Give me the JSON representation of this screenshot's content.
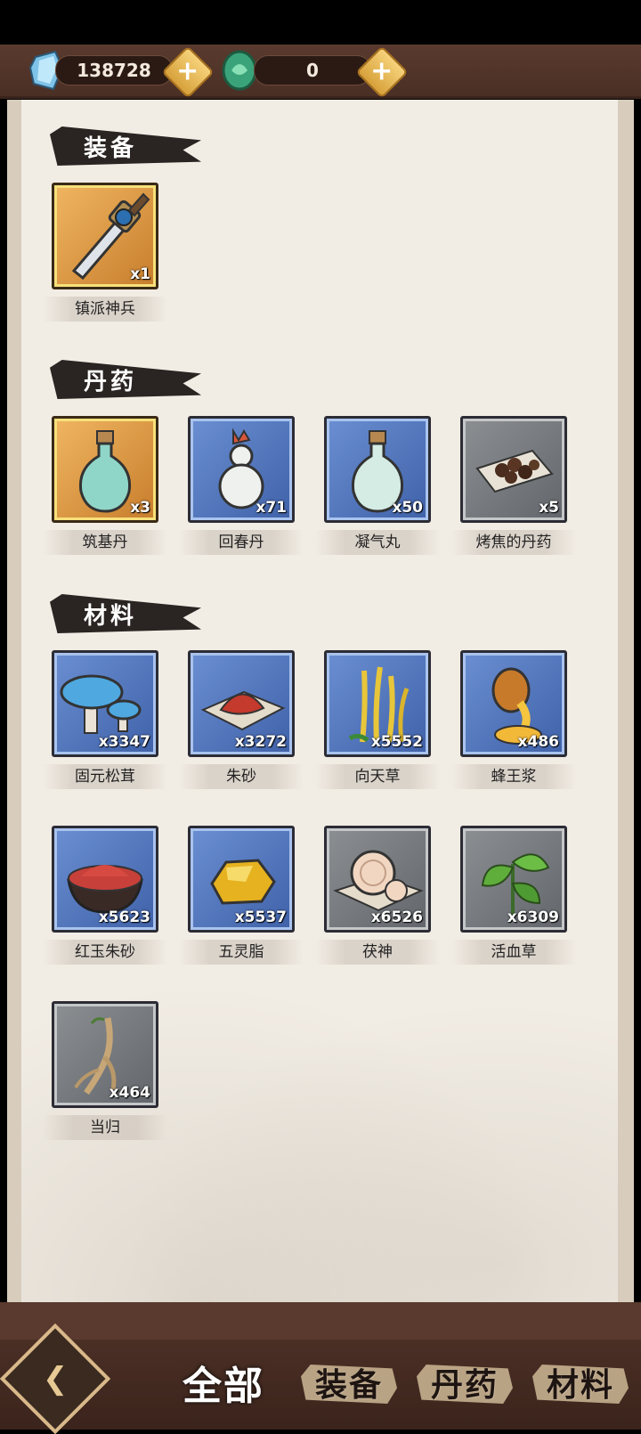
{
  "currency": [
    {
      "icon": "blue-crystal-icon",
      "value": "138728"
    },
    {
      "icon": "jade-coin-icon",
      "value": "0"
    }
  ],
  "sections": [
    {
      "title": "装备",
      "items": [
        {
          "name": "镇派神兵",
          "qty": "x1",
          "rarity": "gold",
          "icon": "sword-icon"
        }
      ]
    },
    {
      "title": "丹药",
      "items": [
        {
          "name": "筑基丹",
          "qty": "x3",
          "rarity": "gold",
          "icon": "jade-bottle-icon"
        },
        {
          "name": "回春丹",
          "qty": "x71",
          "rarity": "blue",
          "icon": "gourd-bottle-icon"
        },
        {
          "name": "凝气丸",
          "qty": "x50",
          "rarity": "blue",
          "icon": "pale-bottle-icon"
        },
        {
          "name": "烤焦的丹药",
          "qty": "x5",
          "rarity": "gray",
          "icon": "burnt-pills-icon"
        }
      ]
    },
    {
      "title": "材料",
      "items": [
        {
          "name": "固元松茸",
          "qty": "x3347",
          "rarity": "blue",
          "icon": "mushroom-icon"
        },
        {
          "name": "朱砂",
          "qty": "x3272",
          "rarity": "blue",
          "icon": "cinnabar-icon"
        },
        {
          "name": "向天草",
          "qty": "x5552",
          "rarity": "blue",
          "icon": "golden-grass-icon"
        },
        {
          "name": "蜂王浆",
          "qty": "x486",
          "rarity": "blue",
          "icon": "honey-jar-icon"
        },
        {
          "name": "红玉朱砂",
          "qty": "x5623",
          "rarity": "blue",
          "icon": "red-bowl-icon"
        },
        {
          "name": "五灵脂",
          "qty": "x5537",
          "rarity": "blue",
          "icon": "amber-nugget-icon"
        },
        {
          "name": "茯神",
          "qty": "x6526",
          "rarity": "gray",
          "icon": "fungus-slice-icon"
        },
        {
          "name": "活血草",
          "qty": "x6309",
          "rarity": "gray",
          "icon": "leaf-herb-icon"
        },
        {
          "name": "当归",
          "qty": "x464",
          "rarity": "gray",
          "icon": "root-icon"
        }
      ]
    }
  ],
  "tabs": [
    {
      "label": "全部",
      "active": true
    },
    {
      "label": "装备",
      "active": false
    },
    {
      "label": "丹药",
      "active": false
    },
    {
      "label": "材料",
      "active": false
    }
  ],
  "colors": {
    "gold": "#e3a24a",
    "blue": "#4f72bc",
    "gray": "#75797d",
    "frame": "#5a3a2e"
  }
}
